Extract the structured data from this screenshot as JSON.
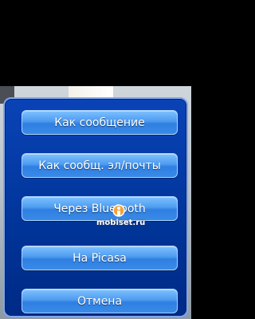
{
  "dialog": {
    "buttons": [
      {
        "label": "Как сообщение"
      },
      {
        "label": "Как сообщ. эл/почты"
      },
      {
        "label": "Через Bluetooth"
      },
      {
        "label": "На Picasa"
      },
      {
        "label": "Отмена"
      }
    ]
  },
  "watermark": {
    "text": "mobiset.ru"
  },
  "colors": {
    "dialog_bg": "#0a43b7",
    "button_top": "#7fc1ff",
    "button_bottom": "#2f7fe2",
    "border": "#7fa6ea"
  }
}
